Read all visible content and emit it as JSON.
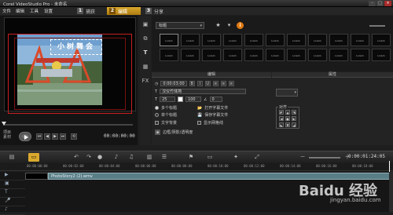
{
  "app": {
    "title": "Corel VideoStudio Pro - 未命名"
  },
  "menu": [
    "文件",
    "编辑",
    "工具",
    "设置"
  ],
  "steps": [
    {
      "num": "1",
      "label": "捕获"
    },
    {
      "num": "2",
      "label": "编辑",
      "active": true
    },
    {
      "num": "3",
      "label": "分享"
    }
  ],
  "window_buttons": [
    "–",
    "□",
    "×"
  ],
  "preview": {
    "overlay_text": "小树舞会",
    "play_labels": [
      "项目",
      "素材"
    ],
    "controls": [
      "⏮",
      "◀",
      "▶",
      "⏭",
      "⟲"
    ],
    "timecode": "00:00:00:00"
  },
  "tool_icons": [
    "media-icon",
    "transition-icon",
    "title-icon",
    "graphic-icon",
    "filter-icon"
  ],
  "library": {
    "category": "标题",
    "thumbnails": [
      "Lorem",
      "Lorem",
      "Lorem",
      "Lorem",
      "Lorem",
      "Lorem",
      "Lorem",
      "Lorem",
      "Lorem",
      "Lorem",
      "Lorem",
      "Lorem",
      "Lorem",
      "Lorem",
      "Lorem",
      "Lorem",
      "Lorem",
      "Lorem",
      "Lorem",
      "Lorem",
      "Lorem",
      "Lorem"
    ]
  },
  "options": {
    "tabs": [
      "编辑",
      "属性"
    ],
    "duration": "0:00:03:00",
    "font": "汉仪竹体简",
    "size": "25",
    "line_spacing": "100",
    "angle": "0",
    "radio_multi": "多个标题",
    "radio_single": "单个标题",
    "check_bg": "文字背景",
    "open_subtitle": "打开字幕文件",
    "save_subtitle": "保存字幕文件",
    "display_bg": "显示网格线",
    "border_label": "边框/阴影/透明度",
    "align_label": "对齐"
  },
  "timeline": {
    "timecode": "0:00:01:24:05",
    "ruler": [
      "00:00:00:00",
      "00:00:02:00",
      "00:00:04:00",
      "00:00:06:00",
      "00:00:08:00",
      "00:00:10:00",
      "00:00:12:00",
      "00:00:14:00",
      "00:00:16:00",
      "00:00:18:00"
    ],
    "clip_name": "PhotoStory2 (2).wmv"
  },
  "watermark": {
    "brand": "Baidu 经验",
    "url": "jingyan.baidu.com"
  }
}
